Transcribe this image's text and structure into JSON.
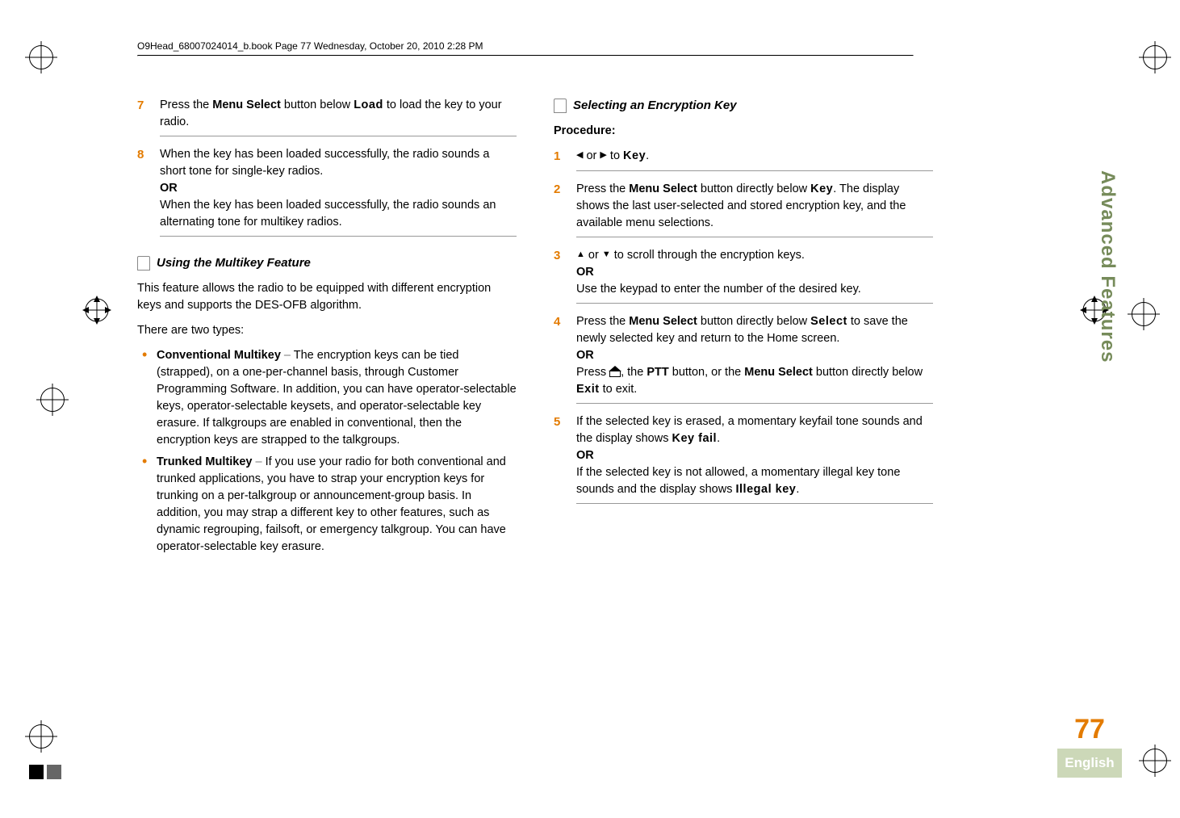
{
  "header": {
    "running": "O9Head_68007024014_b.book  Page 77  Wednesday, October 20, 2010  2:28 PM"
  },
  "side_tab": "Advanced Features",
  "page_number": "77",
  "language": "English",
  "left": {
    "step7": {
      "prefix": "Press the ",
      "btn": "Menu Select",
      "mid": " button below ",
      "screen": "Load",
      "suffix": " to load the key to your radio."
    },
    "step8": {
      "l1": "When the key has been loaded successfully, the radio sounds a short tone for single-key radios.",
      "or": "OR",
      "l2": "When the key has been loaded successfully, the radio sounds an alternating tone for multikey radios."
    },
    "sec_title": "Using the Multikey Feature",
    "para1": "This feature allows the radio to be equipped with different encryption keys and supports the DES-OFB algorithm.",
    "para2": "There are two types:",
    "bul1": {
      "term": "Conventional Multikey",
      "dash": " – ",
      "body": "The encryption keys can be tied (strapped), on a one-per-channel basis, through Customer Programming Software. In addition, you can have operator-selectable keys, operator-selectable keysets, and operator-selectable key erasure. If talkgroups are enabled in conventional, then the encryption keys are strapped to the talkgroups."
    },
    "bul2": {
      "term": "Trunked Multikey",
      "dash": " – ",
      "body": "If you use your radio for both conventional and trunked applications, you have to strap your encryption keys for trunking on a per-talkgroup or announcement-group basis. In addition, you may strap a different key to other features, such as dynamic regrouping, failsoft, or emergency talkgroup. You can have operator-selectable key erasure."
    }
  },
  "right": {
    "sec_title": "Selecting an Encryption Key",
    "procedure_label": "Procedure:",
    "step1": {
      "pre_arrow": "",
      "or_word": " or ",
      "to_word": " to ",
      "screen": "Key",
      "period": "."
    },
    "step2": {
      "prefix": "Press the ",
      "btn": "Menu Select",
      "mid": " button directly below ",
      "screen": "Key",
      "suffix": ". The display shows the last user-selected and stored encryption key, and the available menu selections."
    },
    "step3": {
      "mid_or": " or ",
      "tail": " to scroll through the encryption keys.",
      "or": "OR",
      "l2": "Use the keypad to enter the number of the desired key."
    },
    "step4": {
      "prefix": "Press the ",
      "btn": "Menu Select",
      "mid": " button directly below ",
      "screen": "Select",
      "suffix": " to save the newly selected key and return to the Home screen.",
      "or": "OR",
      "l2a": "Press ",
      "l2b": ", the ",
      "ptt": "PTT",
      "l2c": " button, or the ",
      "btn2": "Menu Select",
      "l2d": " button directly below ",
      "screen2": "Exit",
      "l2e": " to exit."
    },
    "step5": {
      "l1a": "If the selected key is erased, a momentary keyfail tone sounds and the display shows ",
      "screen1": "Key fail",
      "l1b": ".",
      "or": "OR",
      "l2a": "If the selected key is not allowed, a momentary illegal key tone sounds and the display shows ",
      "screen2": "Illegal key",
      "l2b": "."
    }
  }
}
